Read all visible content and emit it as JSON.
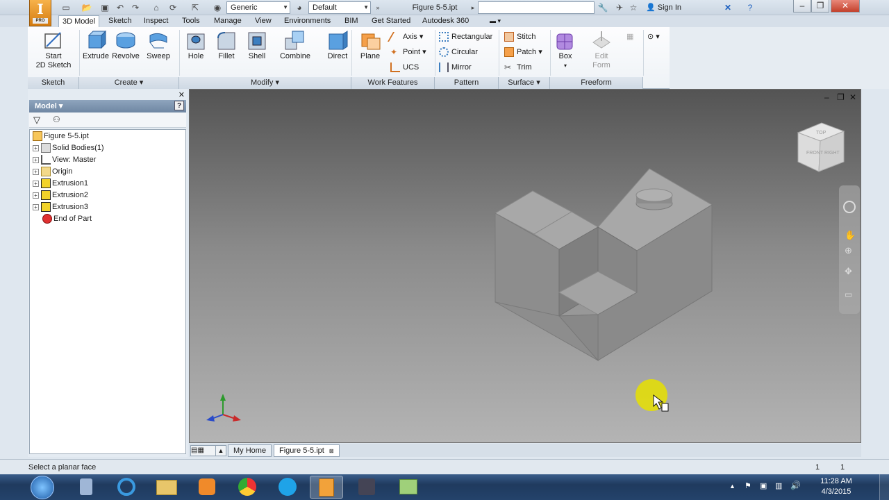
{
  "app": {
    "badge_letter": "I",
    "badge_sub": "PRO",
    "document_title": "Figure 5-5.ipt",
    "search_placeholder": "",
    "sign_in": "Sign In"
  },
  "quick_access": {
    "material": "Generic",
    "appearance": "Default"
  },
  "ribbon_tabs": [
    "3D Model",
    "Sketch",
    "Inspect",
    "Tools",
    "Manage",
    "View",
    "Environments",
    "BIM",
    "Get Started",
    "Autodesk 360"
  ],
  "ribbon": {
    "sketch": {
      "start_line1": "Start",
      "start_line2": "2D Sketch",
      "panel": "Sketch"
    },
    "create": {
      "extrude": "Extrude",
      "revolve": "Revolve",
      "sweep": "Sweep",
      "panel": "Create"
    },
    "modify": {
      "hole": "Hole",
      "fillet": "Fillet",
      "shell": "Shell",
      "combine": "Combine",
      "direct": "Direct",
      "panel": "Modify"
    },
    "work_features": {
      "plane": "Plane",
      "axis": "Axis",
      "point": "Point",
      "ucs": "UCS",
      "panel": "Work Features"
    },
    "pattern": {
      "rectangular": "Rectangular",
      "circular": "Circular",
      "mirror": "Mirror",
      "panel": "Pattern"
    },
    "surface": {
      "stitch": "Stitch",
      "patch": "Patch",
      "trim": "Trim",
      "panel": "Surface"
    },
    "freeform": {
      "box": "Box",
      "edit_line1": "Edit",
      "edit_line2": "Form",
      "panel": "Freeform"
    }
  },
  "browser": {
    "title": "Model",
    "help": "?",
    "tree": [
      {
        "label": "Figure 5-5.ipt",
        "icon": "part-icon",
        "expandable": false
      },
      {
        "label": "Solid Bodies(1)",
        "icon": "solid-bodies-icon",
        "expandable": true
      },
      {
        "label": "View: Master",
        "icon": "view-icon",
        "expandable": true
      },
      {
        "label": "Origin",
        "icon": "folder-icon",
        "expandable": true
      },
      {
        "label": "Extrusion1",
        "icon": "extrusion-icon",
        "expandable": true
      },
      {
        "label": "Extrusion2",
        "icon": "extrusion-icon",
        "expandable": true
      },
      {
        "label": "Extrusion3",
        "icon": "extrusion-icon",
        "expandable": true
      },
      {
        "label": "End of Part",
        "icon": "end-of-part-icon",
        "expandable": false
      }
    ]
  },
  "viewcube": {
    "face_front": "FRONT",
    "face_right": "RIGHT",
    "face_top": "TOP"
  },
  "document_tabs": [
    "My Home",
    "Figure 5-5.ipt"
  ],
  "status": {
    "message": "Select a planar face",
    "count1": "1",
    "count2": "1"
  },
  "taskbar": {
    "time": "11:28 AM",
    "date": "4/3/2015"
  },
  "colors": {
    "ribbon_bg": "#f3f6f9",
    "viewport_top": "#545454",
    "viewport_bottom": "#b4b4b4",
    "model_top": "#a9a9a9",
    "model_side": "#8c8c8c",
    "cursor_highlight": "#e6e100"
  }
}
